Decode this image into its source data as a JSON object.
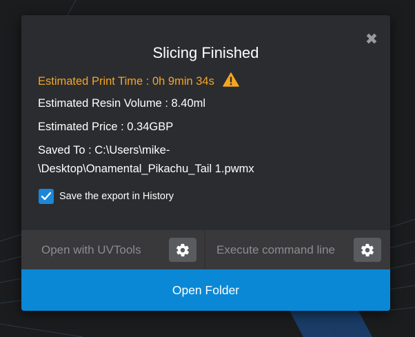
{
  "dialog": {
    "title": "Slicing Finished",
    "close_symbol": "✖",
    "info": {
      "print_time": "Estimated Print Time : 0h 9min 34s",
      "resin_volume": "Estimated Resin Volume : 8.40ml",
      "price": "Estimated Price : 0.34GBP",
      "saved_to_line1": "Saved To : C:\\Users\\mike-",
      "saved_to_line2": "\\Desktop\\Onamental_Pikachu_Tail 1.pwmx"
    },
    "save_history": {
      "label": "Save the export in History",
      "checked": true
    },
    "buttons": {
      "open_uvtools": "Open with UVTools",
      "execute_command": "Execute command line",
      "open_folder": "Open Folder"
    }
  },
  "icons": {
    "warning": "warning-triangle-icon",
    "close": "close-icon",
    "check": "check-icon",
    "gear": "gear-icon"
  },
  "colors": {
    "warning": "#f4a623",
    "accent_blue": "#0a88d6",
    "dialog_bg": "#2b2c2f",
    "button_bar_bg": "#39393c",
    "gear_button_bg": "#5a5b5e"
  }
}
